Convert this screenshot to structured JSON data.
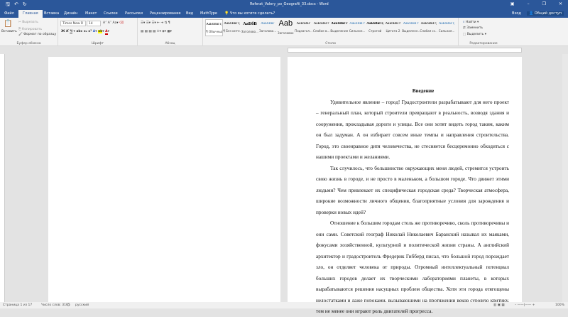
{
  "titlebar": {
    "title": "Referat_Valery_po_Geografii_33.docx - Word",
    "icons": [
      "save-icon",
      "undo-icon",
      "redo-icon"
    ]
  },
  "tabs": [
    "Файл",
    "Главная",
    "Вставка",
    "Дизайн",
    "Макет",
    "Ссылки",
    "Рассылки",
    "Рецензирование",
    "Вид",
    "MathType"
  ],
  "tell_me": "Что вы хотите сделать?",
  "signin": "Вход",
  "share": "Общий доступ",
  "clipboard": {
    "paste": "Вставить",
    "cut": "Вырезать",
    "copy": "Копировать",
    "format": "Формат по образцу",
    "label": "Буфер обмена"
  },
  "font": {
    "name": "Times New R",
    "size": "14",
    "label": "Шрифт"
  },
  "paragraph": {
    "label": "Абзац"
  },
  "styles": {
    "label": "Стили",
    "items": [
      {
        "pv": "АаБбВвГг,",
        "nm": "¶ Обычный"
      },
      {
        "pv": "АаБбВвГг,",
        "nm": "¶ Без инте..."
      },
      {
        "pv": "АаБбВ",
        "nm": "Заголово..."
      },
      {
        "pv": "АаБбВвГ",
        "nm": "Заголово..."
      },
      {
        "pv": "Aab",
        "nm": "Заголовок"
      },
      {
        "pv": "АаБбВвГ",
        "nm": "Подзагол..."
      },
      {
        "pv": "АаБбВвГг",
        "nm": "Слабое в..."
      },
      {
        "pv": "АаБбВвГг",
        "nm": "Выделение"
      },
      {
        "pv": "АаБбВвГг",
        "nm": "Сильное..."
      },
      {
        "pv": "АаБбВвГг,",
        "nm": "Строгий"
      },
      {
        "pv": "АаБбВвГг",
        "nm": "Цитата 2"
      },
      {
        "pv": "АаБбВвГг",
        "nm": "Выделенн..."
      },
      {
        "pv": "АаБбВвГг,",
        "nm": "Слабая сс..."
      },
      {
        "pv": "АаБбВвГг,",
        "nm": "Сильная..."
      }
    ]
  },
  "editing": {
    "find": "Найти",
    "replace": "Заменить",
    "select": "Выделить",
    "label": "Редактирование"
  },
  "document": {
    "heading": "Введение",
    "paragraphs": [
      "Удивительное явление – город! Градостроители разрабатывают для него проект – генеральный план, который строители превращают в реальность, возводя здания и сооружения, прокладывая дороги и улицы. Все они хотят видеть город таким, каким он был задуман. А он избирает совсем иные темпы и направления строительства. Город, это своенравное дитя человечества, не стесняется бесцеремонно обходиться с нашими проектами и желаниями.",
      "Так случилось, что большинство окружающих меня людей, стремится устроить свою жизнь в городе, и не просто в маленьком, а большом городе. Что движет этими людьми? Чем привлекает их специфическая городская среда? Творческая атмосфера, широкие возможности личного общения, благоприятные условия для зарождения и проверки новых идей?",
      "Отношение к большим городам столь же противоречиво, сколь противоречивы и они сами. Советский географ Николай Николаевич Баранский называл их маяками, фокусами хозяйственной, культурной и политической жизни страны. А английский архитектор и градостроитель Фредерик Гибберд писал, что большой город порождает зло, он отделяет человека от природы. Огромный интеллектуальный потенциал больших городов делает их творческими лабораториями планеты, в которых вырабатываются решения насущных проблем общества. Хотя эти города отягощены недостатками и даже пороками, вызывающими на протяжении веков суровую критику, тем не менее они играют роль двигателей прогресса."
    ]
  },
  "status": {
    "page": "Страница 1 из 17",
    "words": "Число слов: 3165",
    "lang": "русский",
    "zoom": "100%"
  }
}
